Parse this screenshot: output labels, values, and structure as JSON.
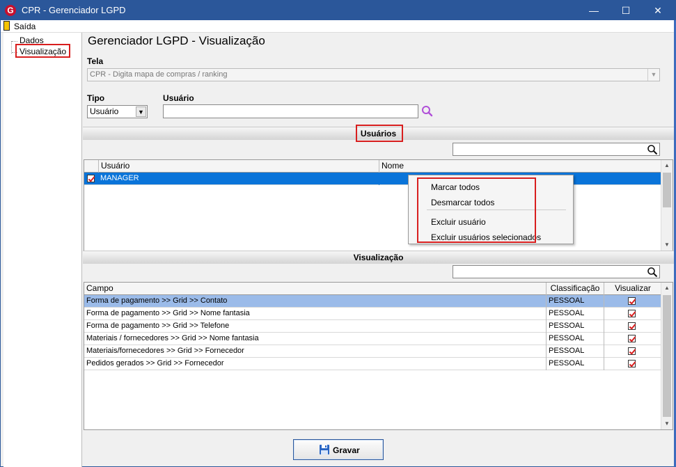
{
  "window": {
    "title": "CPR - Gerenciador LGPD",
    "app_icon_letter": "G",
    "controls": {
      "minimize": "—",
      "maximize": "☐",
      "close": "✕"
    }
  },
  "menu": {
    "exit_label": "Saída"
  },
  "tree": {
    "items": [
      "Dados",
      "Visualização"
    ]
  },
  "main": {
    "title": "Gerenciador LGPD - Visualização",
    "tela_label": "Tela",
    "tela_value": "CPR - Digita mapa de compras / ranking",
    "tipo_label": "Tipo",
    "tipo_value": "Usuário",
    "usuario_label": "Usuário",
    "usuario_value": ""
  },
  "users_section": {
    "title": "Usuários",
    "columns": [
      "Usuário",
      "Nome"
    ],
    "rows": [
      {
        "usuario": "MANAGER",
        "nome": "",
        "checked": true,
        "selected": true
      }
    ]
  },
  "context_menu": {
    "items": [
      "Marcar todos",
      "Desmarcar todos",
      "Excluir usuário",
      "Excluir usuários selecionados"
    ]
  },
  "view_section": {
    "title": "Visualização",
    "columns": [
      "Campo",
      "Classificação",
      "Visualizar"
    ],
    "rows": [
      {
        "campo": "Forma de pagamento >> Grid >> Contato",
        "classificacao": "PESSOAL",
        "visualizar": true
      },
      {
        "campo": "Forma de pagamento >> Grid >> Nome fantasia",
        "classificacao": "PESSOAL",
        "visualizar": true
      },
      {
        "campo": "Forma de pagamento >> Grid >> Telefone",
        "classificacao": "PESSOAL",
        "visualizar": true
      },
      {
        "campo": "Materiais / fornecedores >> Grid >> Nome fantasia",
        "classificacao": "PESSOAL",
        "visualizar": true
      },
      {
        "campo": "Materiais/fornecedores >> Grid >> Fornecedor",
        "classificacao": "PESSOAL",
        "visualizar": true
      },
      {
        "campo": "Pedidos gerados >> Grid >> Fornecedor",
        "classificacao": "PESSOAL",
        "visualizar": true
      }
    ]
  },
  "footer": {
    "save_label": "Gravar"
  },
  "colors": {
    "titlebar": "#2b579a",
    "selection": "#0a74d9",
    "highlight_row": "#9bbbe9",
    "annotation_red": "#d81e1e"
  }
}
